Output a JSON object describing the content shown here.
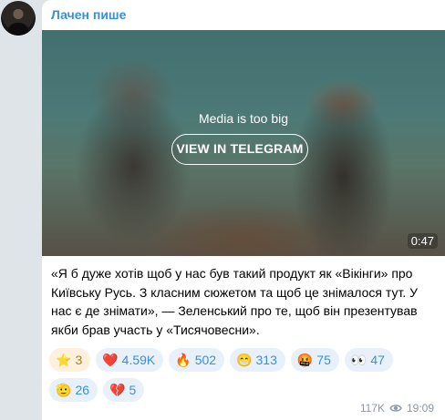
{
  "channel": {
    "name": "Лачен пише"
  },
  "media": {
    "notice": "Media is too big",
    "button_label": "VIEW IN TELEGRAM",
    "duration": "0:47"
  },
  "message": {
    "text": "«Я б дуже хотів щоб у нас був такий продукт як «Вікінги» про Київську Русь. З класним сюжетом та щоб це знімалося тут. У нас є де знімати», — Зеленський про те, щоб він презентував якби брав участь у «Тисячовесни»."
  },
  "reactions": [
    {
      "icon": "star-icon",
      "glyph": "⭐",
      "count": "3"
    },
    {
      "icon": "heart-icon",
      "glyph": "❤️",
      "count": "4.59K"
    },
    {
      "icon": "fire-icon",
      "glyph": "🔥",
      "count": "502"
    },
    {
      "icon": "grinning-face-icon",
      "glyph": "😁",
      "count": "313"
    },
    {
      "icon": "angry-face-icon",
      "glyph": "🤬",
      "count": "75"
    },
    {
      "icon": "eyes-icon",
      "glyph": "👀",
      "count": "47"
    },
    {
      "icon": "hand-icon",
      "glyph": "🫡",
      "count": "26"
    },
    {
      "icon": "broken-heart-icon",
      "glyph": "💔",
      "count": "5"
    }
  ],
  "footer": {
    "views": "117K",
    "time": "19:09"
  },
  "colors": {
    "accent": "#3a8fd1",
    "background": "#dfe4e8",
    "bubble": "#ffffff"
  }
}
